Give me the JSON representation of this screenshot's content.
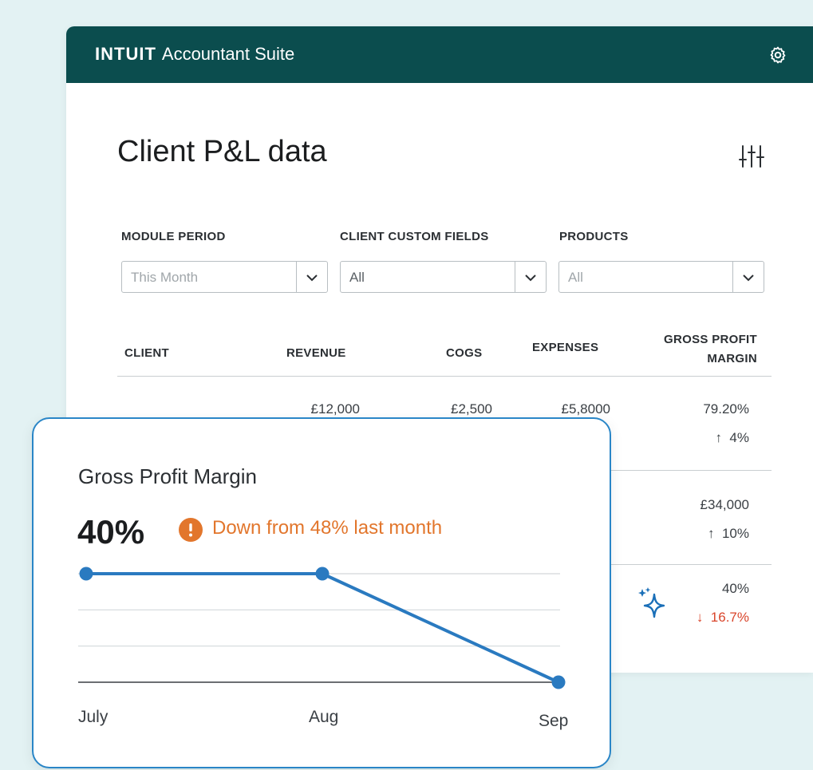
{
  "header": {
    "logo": "INTUIT",
    "suite": "Accountant Suite",
    "settings_icon": "gear-icon"
  },
  "page": {
    "title": "Client P&L data",
    "filter_icon": "sliders-icon"
  },
  "filters": [
    {
      "label": "MODULE PERIOD",
      "placeholder": "This Month"
    },
    {
      "label": "CLIENT CUSTOM FIELDS",
      "value": "All"
    },
    {
      "label": "PRODUCTS",
      "placeholder": "All"
    }
  ],
  "table": {
    "columns": [
      "CLIENT",
      "REVENUE",
      "COGS",
      "EXPENSES",
      "GROSS PROFIT",
      "MARGIN"
    ],
    "rows": [
      {
        "revenue": "£12,000",
        "cogs": "£2,500",
        "expenses": "£5,8000",
        "margin": "79.20%",
        "trend": "4%",
        "trend_dir": "up"
      },
      {
        "margin": "£34,000",
        "trend": "10%",
        "trend_dir": "up"
      },
      {
        "margin": "40%",
        "trend": "16.7%",
        "trend_dir": "down"
      }
    ]
  },
  "card": {
    "title": "Gross Profit Margin",
    "value": "40%",
    "alert": "Down from 48% last month",
    "alert_color": "#e2762c"
  },
  "chart_data": {
    "type": "line",
    "x": [
      "July",
      "Aug",
      "Sep"
    ],
    "values": [
      48,
      48,
      40
    ],
    "ylim": [
      40,
      48
    ],
    "grid": true,
    "color": "#2a7ac0"
  },
  "colors": {
    "topbar": "#0b4d4e",
    "card_border": "#2a86c7",
    "down": "#d9452b"
  }
}
